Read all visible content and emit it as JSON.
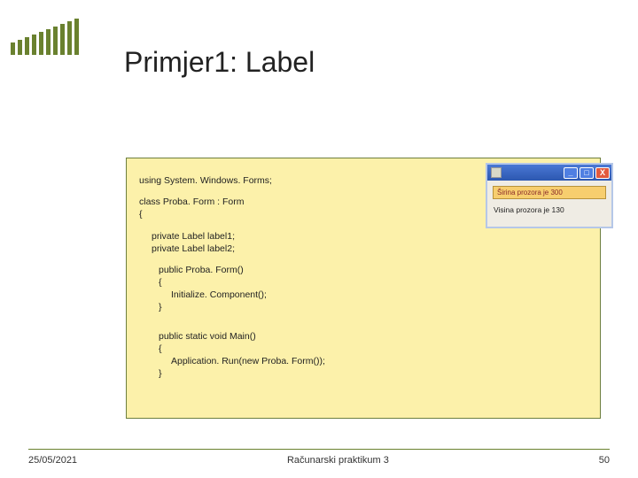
{
  "title": "Primjer1: Label",
  "code": {
    "using": "using System. Windows. Forms;",
    "class_decl": "class Proba. Form : Form",
    "brace_open": "{",
    "field1": "private Label label1;",
    "field2": "private Label label2;",
    "ctor_sig": "public Proba. Form()",
    "ctor_open": "{",
    "ctor_body": "Initialize. Component();",
    "ctor_close": "}",
    "main_sig": "public static void Main()",
    "main_open": "{",
    "main_body": "Application. Run(new Proba. Form());",
    "main_close": "}"
  },
  "window": {
    "label1_text": "Širina prozora je 300",
    "label2_text": "Visina prozora je 130",
    "minimize": "_",
    "maximize": "□",
    "close": "X"
  },
  "footer": {
    "date": "25/05/2021",
    "course": "Računarski praktikum 3",
    "page": "50"
  }
}
